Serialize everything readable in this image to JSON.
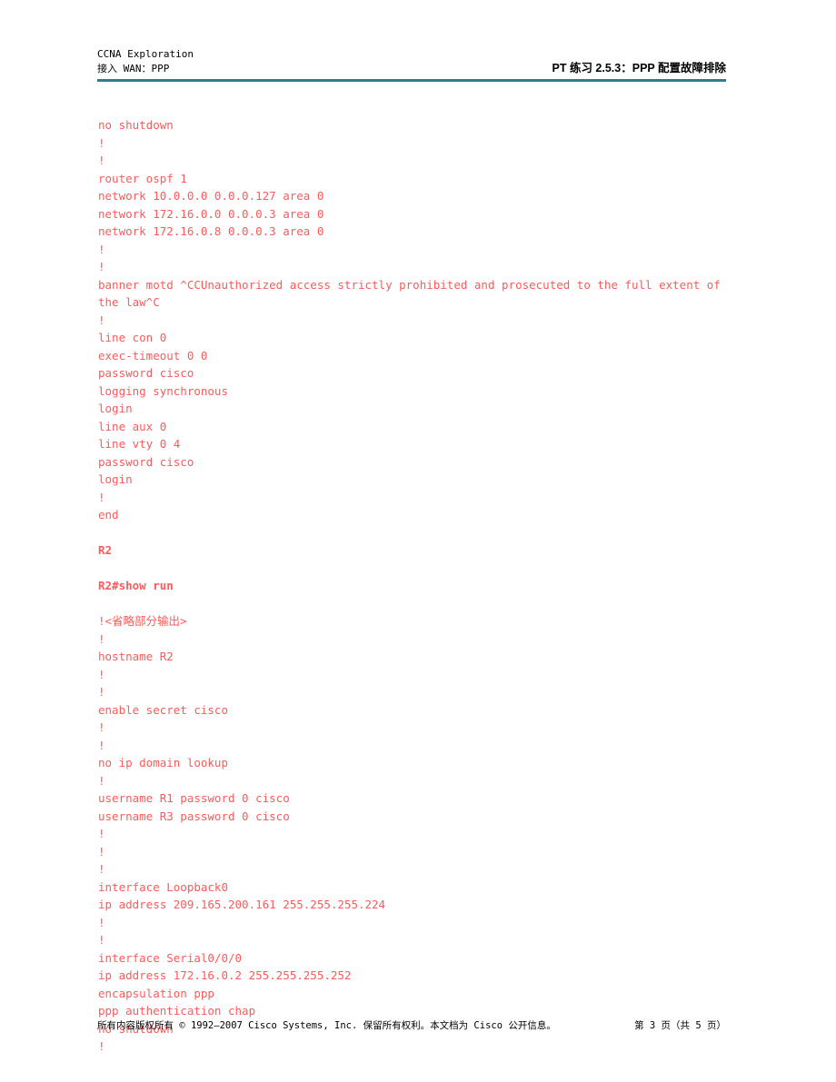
{
  "header": {
    "course_title": "CCNA Exploration",
    "course_subtitle": "接入 WAN：PPP",
    "document_title": "PT 练习 2.5.3：PPP 配置故障排除",
    "rule_color": "#2e7f8c"
  },
  "body": {
    "text_color": "#fc5a5a",
    "lines": [
      {
        "text": "no shutdown",
        "bold": false
      },
      {
        "text": "!",
        "bold": false
      },
      {
        "text": "!",
        "bold": false
      },
      {
        "text": "router ospf 1",
        "bold": false
      },
      {
        "text": "network 10.0.0.0 0.0.0.127 area 0",
        "bold": false
      },
      {
        "text": "network 172.16.0.0 0.0.0.3 area 0",
        "bold": false
      },
      {
        "text": "network 172.16.0.8 0.0.0.3 area 0",
        "bold": false
      },
      {
        "text": "!",
        "bold": false
      },
      {
        "text": "!",
        "bold": false
      },
      {
        "text": "banner motd ^CCUnauthorized access strictly prohibited and prosecuted to the full extent of the law^C",
        "bold": false,
        "wrap": true
      },
      {
        "text": "!",
        "bold": false
      },
      {
        "text": "line con 0",
        "bold": false
      },
      {
        "text": "exec-timeout 0 0",
        "bold": false
      },
      {
        "text": "password cisco",
        "bold": false
      },
      {
        "text": "logging synchronous",
        "bold": false
      },
      {
        "text": "login",
        "bold": false
      },
      {
        "text": "line aux 0",
        "bold": false
      },
      {
        "text": "line vty 0 4",
        "bold": false
      },
      {
        "text": "password cisco",
        "bold": false
      },
      {
        "text": "login",
        "bold": false
      },
      {
        "text": "!",
        "bold": false
      },
      {
        "text": "end",
        "bold": false
      },
      {
        "text": "",
        "bold": false
      },
      {
        "text": "R2",
        "bold": true
      },
      {
        "text": "",
        "bold": false
      },
      {
        "text": "R2#show run",
        "bold": true
      },
      {
        "text": "",
        "bold": false
      },
      {
        "text": "!<省略部分输出>",
        "bold": false
      },
      {
        "text": "!",
        "bold": false
      },
      {
        "text": "hostname R2",
        "bold": false
      },
      {
        "text": "!",
        "bold": false
      },
      {
        "text": "!",
        "bold": false
      },
      {
        "text": "enable secret cisco",
        "bold": false
      },
      {
        "text": "!",
        "bold": false
      },
      {
        "text": "!",
        "bold": false
      },
      {
        "text": "no ip domain lookup",
        "bold": false
      },
      {
        "text": "!",
        "bold": false
      },
      {
        "text": "username R1 password 0 cisco",
        "bold": false
      },
      {
        "text": "username R3 password 0 cisco",
        "bold": false
      },
      {
        "text": "!",
        "bold": false
      },
      {
        "text": "!",
        "bold": false
      },
      {
        "text": "!",
        "bold": false
      },
      {
        "text": "interface Loopback0",
        "bold": false
      },
      {
        "text": "ip address 209.165.200.161 255.255.255.224",
        "bold": false
      },
      {
        "text": "!",
        "bold": false
      },
      {
        "text": "!",
        "bold": false
      },
      {
        "text": "interface Serial0/0/0",
        "bold": false
      },
      {
        "text": "ip address 172.16.0.2 255.255.255.252",
        "bold": false
      },
      {
        "text": "encapsulation ppp",
        "bold": false
      },
      {
        "text": "ppp authentication chap",
        "bold": false
      },
      {
        "text": "no shutdown",
        "bold": false
      },
      {
        "text": "!",
        "bold": false
      }
    ]
  },
  "footer": {
    "copyright": "所有内容版权所有 © 1992–2007 Cisco Systems, Inc. 保留所有权利。本文档为 Cisco 公开信息。",
    "page_indicator": "第 3 页（共 5 页）"
  }
}
